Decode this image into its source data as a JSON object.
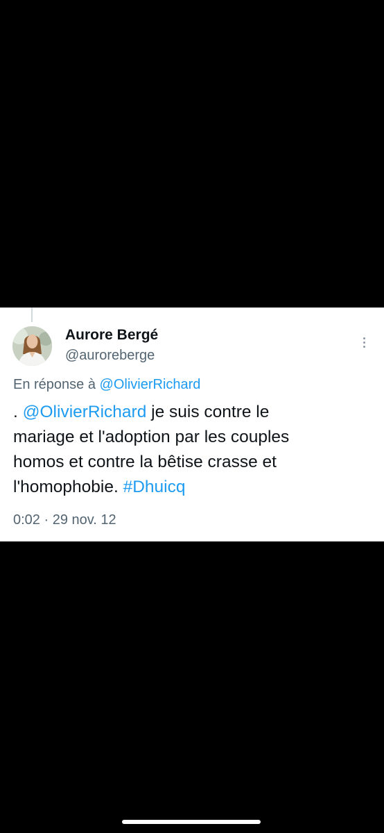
{
  "tweet": {
    "author": {
      "display_name": "Aurore Bergé",
      "handle": "@auroreberge"
    },
    "reply_prefix": "En réponse à ",
    "reply_to": "@OlivierRichard",
    "text_lines": [
      {
        "plain_before": ". ",
        "mention": "@OlivierRichard",
        "plain_after": " je suis contre le"
      },
      {
        "plain": "mariage et l'adoption par les couples"
      },
      {
        "plain": "homos et contre la bêtise crasse et"
      },
      {
        "plain_before": "l'homophobie. ",
        "hashtag": "#Dhuicq"
      }
    ],
    "timestamp": "0:02 · 29 nov. 12"
  },
  "icons": {
    "more": "more-vertical-icon",
    "avatar": "profile-photo"
  },
  "colors": {
    "background": "#000000",
    "card": "#ffffff",
    "link": "#1d9bf0",
    "primary_text": "#0f1419",
    "secondary_text": "#536471"
  }
}
